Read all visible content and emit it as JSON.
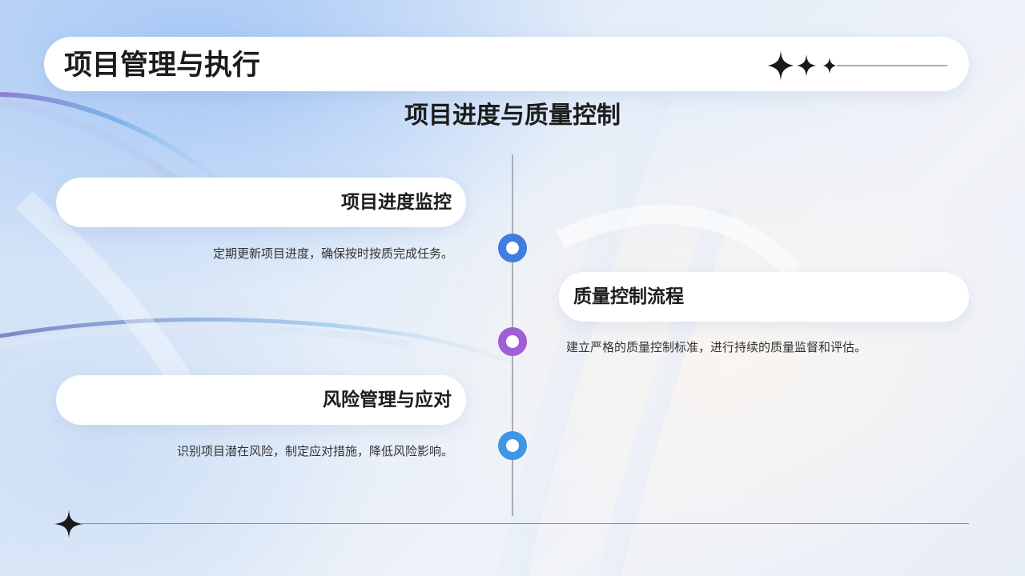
{
  "slide": {
    "title": "项目管理与执行",
    "section_title": "项目进度与质量控制"
  },
  "timeline": {
    "items": [
      {
        "label": "项目进度监控",
        "description": "定期更新项目进度，确保按时按质完成任务。",
        "side": "left",
        "dot_color": "#3f7de0"
      },
      {
        "label": "质量控制流程",
        "description": "建立严格的质量控制标准，进行持续的质量监督和评估。",
        "side": "right",
        "dot_color": "#a05fd6"
      },
      {
        "label": "风险管理与应对",
        "description": "识别项目潜在风险，制定应对措施，降低风险影响。",
        "side": "left",
        "dot_color": "#3f95e6"
      }
    ]
  },
  "decor": {
    "header_icon": "three-sparkles-icon",
    "footer_icon": "sparkle-icon"
  }
}
